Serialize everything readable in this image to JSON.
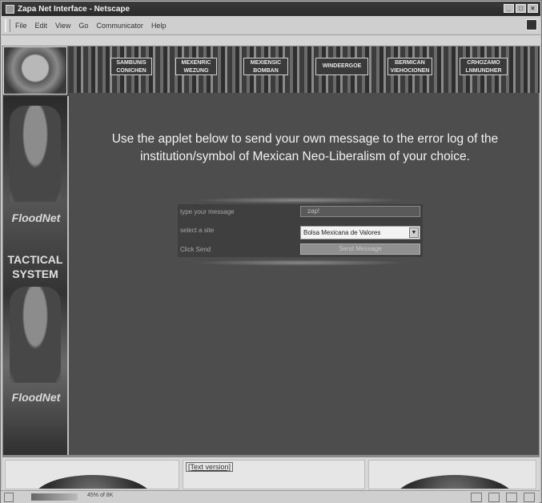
{
  "window": {
    "title": "Zapa Net Interface - Netscape"
  },
  "menu": {
    "items": [
      "File",
      "Edit",
      "View",
      "Go",
      "Communicator",
      "Help"
    ]
  },
  "banner": {
    "buttons": [
      {
        "line1": "SAMBUNIS",
        "line2": "CONICHEN"
      },
      {
        "line1": "MEXENRIC",
        "line2": "WEZUNG"
      },
      {
        "line1": "MEXIENSIC",
        "line2": "BOMBAN"
      },
      {
        "line1": "WINDEERGOE",
        "line2": ""
      },
      {
        "line1": "BERMICAN",
        "line2": "VIEHOCIONEN"
      },
      {
        "line1": "CRHOZAMO",
        "line2": "LNMUNDHER"
      }
    ]
  },
  "sidebar": {
    "brand_top": "FloodNet",
    "tactical_line1": "TACTICAL",
    "tactical_line2": "SYSTEM",
    "brand_bottom": "FloodNet"
  },
  "main": {
    "headline": "Use the applet below to send your own message to the error log of the institution/symbol of Mexican Neo-Liberalism of your choice."
  },
  "applet": {
    "label_message": "type your message",
    "message_value": "zap!",
    "label_site": "select a site",
    "site_selected": "Bolsa Mexicana de Valores",
    "label_send": "Click Send",
    "send_button": "Send Message"
  },
  "footer": {
    "text_version_link": "[Text version]"
  },
  "status": {
    "text": "45% of 8K"
  }
}
